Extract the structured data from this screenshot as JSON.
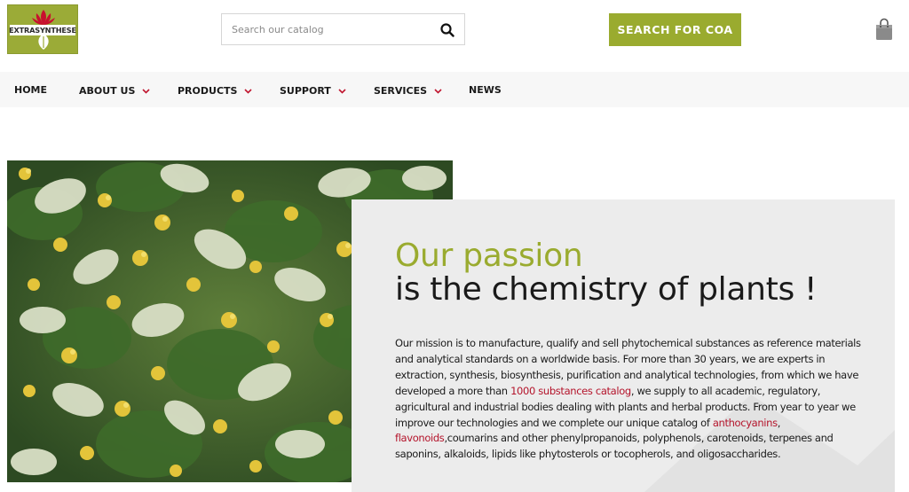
{
  "logo": {
    "text": "EXTRASYNTHESE"
  },
  "search": {
    "placeholder": "Search our catalog",
    "value": ""
  },
  "coa_button": {
    "label": "SEARCH FOR COA"
  },
  "nav": {
    "home": "HOME",
    "about": "ABOUT US",
    "products": "PRODUCTS",
    "support": "SUPPORT",
    "services": "SERVICES",
    "news": "NEWS"
  },
  "hero": {
    "title_line1": "Our passion",
    "title_line2": "is the chemistry of plants !",
    "mission": {
      "part1": "Our mission is to manufacture, qualify and sell phytochemical substances as reference materials and analytical standards on a worldwide basis. For more than 30 years, we are experts in extraction, synthesis, biosynthesis, purification and analytical technologies, from which we have developed a more than ",
      "link1": "1000 substances catalog",
      "part2": ", we supply to all academic, regulatory, agricultural and industrial bodies dealing with plants and herbal products. From year to year we improve our technologies and we complete our unique catalog of ",
      "link2": "anthocyanins",
      "part3": ", ",
      "link3": "flavonoids",
      "part4": ",coumarins and other phenylpropanoids, polyphenols, carotenoids, terpenes and saponins, alkaloids, lipids like phytosterols or tocopherols, and oligosaccharides."
    }
  },
  "icons": {
    "search": "search-icon",
    "cart": "shopping-bag-icon",
    "chevron": "chevron-down-icon"
  },
  "colors": {
    "brand_green": "#9aab2f",
    "link_red": "#b4142b",
    "chevron_red": "#c0162f",
    "nav_bg": "#f7f7f7",
    "panel_bg": "#ececec"
  }
}
